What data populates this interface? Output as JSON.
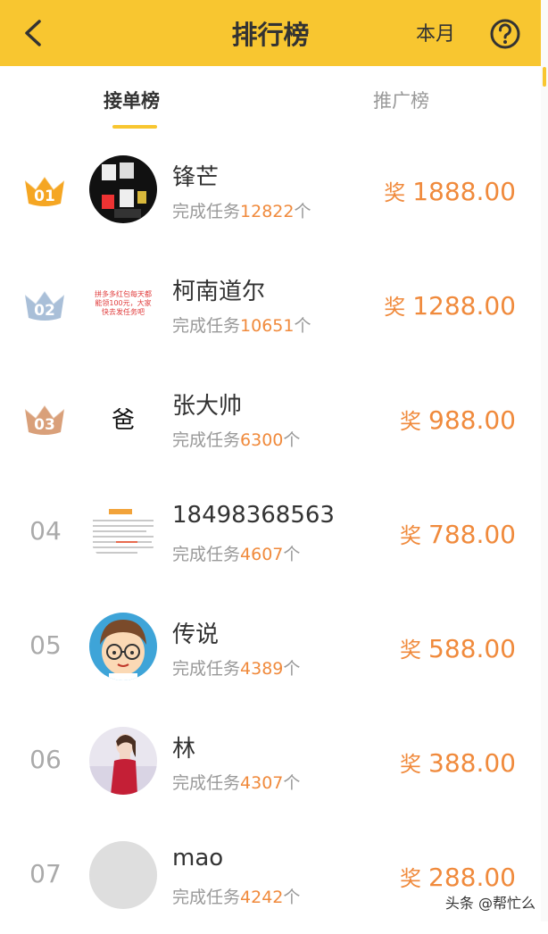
{
  "header": {
    "title": "排行榜",
    "period": "本月"
  },
  "tabs": [
    {
      "label": "接单榜",
      "active": true
    },
    {
      "label": "推广榜",
      "active": false
    }
  ],
  "rows": [
    {
      "rank": "01",
      "name": "锋芒",
      "sub_prefix": "完成任务",
      "count": "12822",
      "sub_suffix": "个",
      "prize_label": "奖",
      "prize": "1888.00",
      "avatar": "letters-photo"
    },
    {
      "rank": "02",
      "name": "柯南道尔",
      "sub_prefix": "完成任务",
      "count": "10651",
      "sub_suffix": "个",
      "prize_label": "奖",
      "prize": "1288.00",
      "avatar": "text-image",
      "avatar_text": "拼多多红包每天都能领100元，大家快去发任务吧"
    },
    {
      "rank": "03",
      "name": "张大帅",
      "sub_prefix": "完成任务",
      "count": "6300",
      "sub_suffix": "个",
      "prize_label": "奖",
      "prize": "988.00",
      "avatar": "text-char",
      "avatar_text": "爸"
    },
    {
      "rank": "04",
      "name": "18498368563",
      "sub_prefix": "完成任务",
      "count": "4607",
      "sub_suffix": "个",
      "prize_label": "奖",
      "prize": "788.00",
      "avatar": "document-image"
    },
    {
      "rank": "05",
      "name": "传说",
      "sub_prefix": "完成任务",
      "count": "4389",
      "sub_suffix": "个",
      "prize_label": "奖",
      "prize": "588.00",
      "avatar": "cartoon-boy"
    },
    {
      "rank": "06",
      "name": "林",
      "sub_prefix": "完成任务",
      "count": "4307",
      "sub_suffix": "个",
      "prize_label": "奖",
      "prize": "388.00",
      "avatar": "woman-photo"
    },
    {
      "rank": "07",
      "name": "mao",
      "sub_prefix": "完成任务",
      "count": "4242",
      "sub_suffix": "个",
      "prize_label": "奖",
      "prize": "288.00",
      "avatar": "placeholder"
    }
  ],
  "watermark": "头条 @帮忙么",
  "colors": {
    "accent": "#f8c630",
    "prize": "#f08a3c",
    "gold": "#f5a623",
    "silver": "#a9bfd8",
    "bronze": "#d9a07a"
  }
}
